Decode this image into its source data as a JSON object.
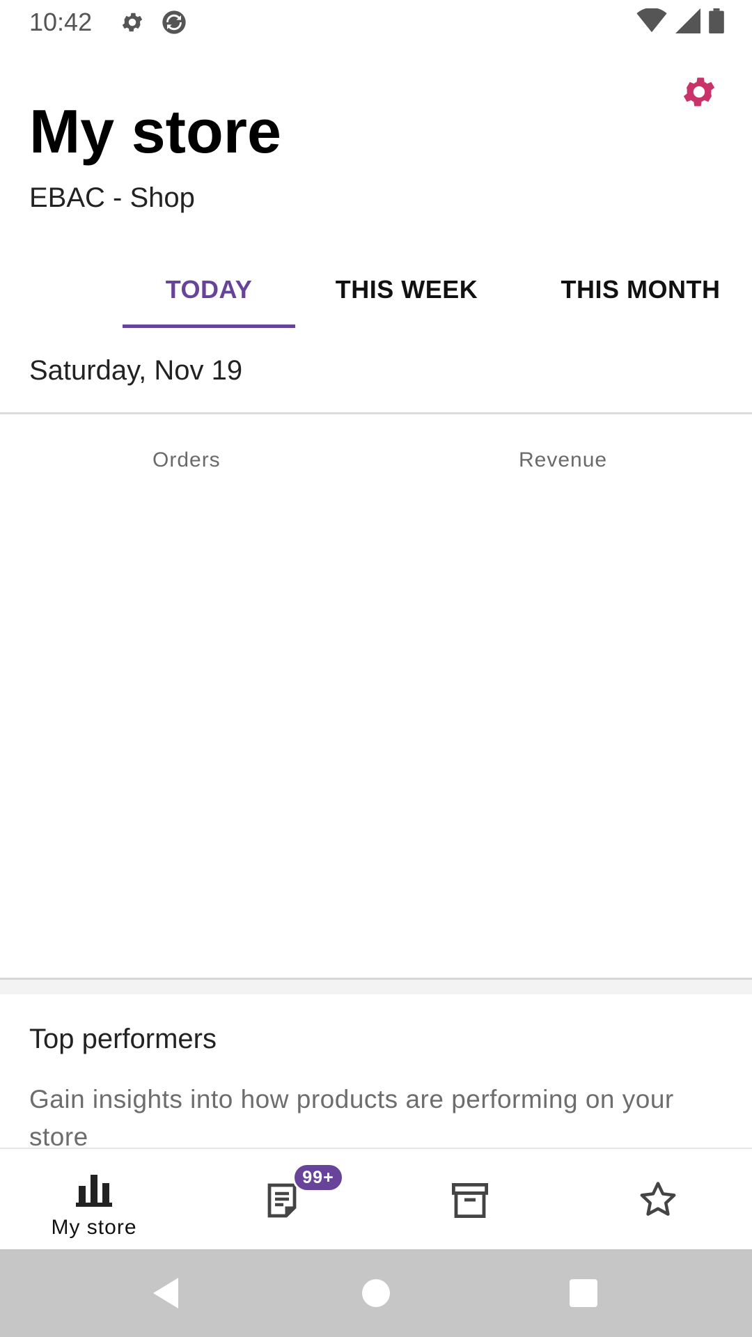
{
  "status_bar": {
    "time": "10:42",
    "icons": [
      "gear-icon",
      "sync-icon",
      "wifi-icon",
      "signal-icon",
      "battery-icon"
    ]
  },
  "header": {
    "title": "My store",
    "store_name": "EBAC - Shop",
    "settings_icon": "settings-gear-icon",
    "accent_color": "#c9336a"
  },
  "tabs": [
    {
      "label": "TODAY",
      "active": true
    },
    {
      "label": "THIS WEEK",
      "active": false
    },
    {
      "label": "THIS MONTH",
      "active": false
    }
  ],
  "date_label": "Saturday, Nov 19",
  "stats": {
    "orders_label": "Orders",
    "revenue_label": "Revenue"
  },
  "top_performers": {
    "title": "Top performers",
    "description": "Gain insights into how products are performing on your store"
  },
  "bottom_nav": {
    "items": [
      {
        "label": "My store",
        "icon": "bar-chart-icon",
        "active": true
      },
      {
        "label": "",
        "icon": "orders-icon",
        "badge": "99+"
      },
      {
        "label": "",
        "icon": "products-archive-icon"
      },
      {
        "label": "",
        "icon": "reviews-star-icon"
      }
    ]
  },
  "system_nav": [
    "back-icon",
    "home-icon",
    "recents-icon"
  ],
  "colors": {
    "primary": "#674399",
    "settings": "#c9336a"
  }
}
